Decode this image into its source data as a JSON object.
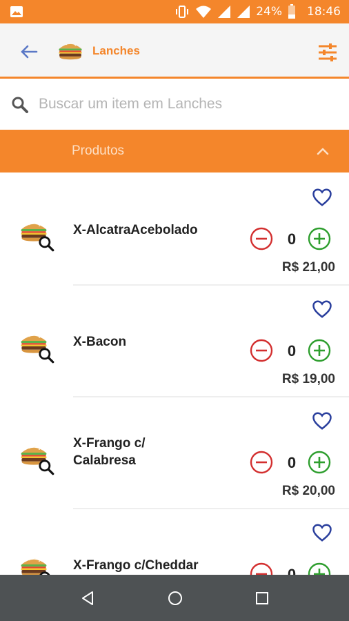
{
  "status_bar": {
    "battery_percent": "24%",
    "time": "18:46",
    "icons": [
      "image-icon",
      "vibrate-icon",
      "wifi-icon",
      "signal-icon",
      "signal-icon",
      "battery-icon"
    ]
  },
  "header": {
    "category_title": "Lanches",
    "icons": [
      "back-arrow-icon",
      "burger-icon",
      "filter-sliders-icon"
    ]
  },
  "search": {
    "placeholder": "Buscar um item em Lanches",
    "value": "",
    "icon": "search-icon"
  },
  "section": {
    "label": "Produtos",
    "icon": "chevron-up-icon"
  },
  "products": [
    {
      "name": "X-AlcatraAcebolado",
      "quantity": "0",
      "price": "R$ 21,00"
    },
    {
      "name": "X-Bacon",
      "quantity": "0",
      "price": "R$ 19,00"
    },
    {
      "name": "X-Frango c/\nCalabresa",
      "quantity": "0",
      "price": "R$ 20,00"
    },
    {
      "name": "X-Frango c/Cheddar",
      "quantity": "0",
      "price": ""
    }
  ],
  "nav_bar": {
    "icons": [
      "nav-back-icon",
      "nav-home-icon",
      "nav-recents-icon"
    ]
  },
  "colors": {
    "primary": "#f4862b",
    "minus": "#d32f2f",
    "plus": "#2e9e2e",
    "heart": "#2a3f9d",
    "nav_bar": "#4e5254"
  }
}
